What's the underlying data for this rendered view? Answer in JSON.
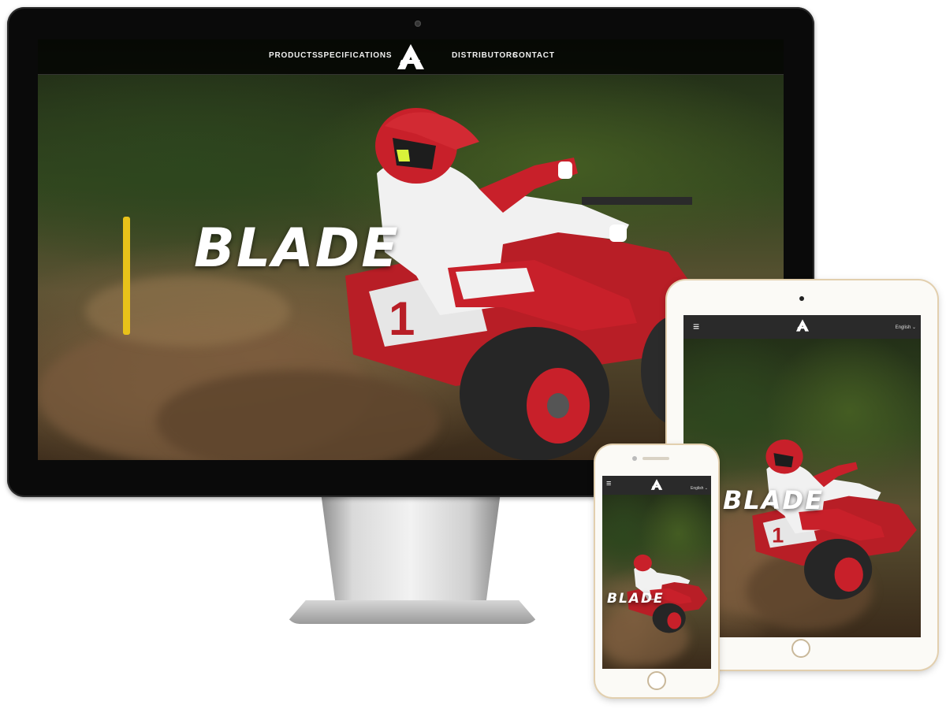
{
  "desktop": {
    "nav": {
      "left_items": [
        "PRODUCTS",
        "SPECIFICATIONS"
      ],
      "right_items": [
        "DISTRIBUTORS",
        "CONTACT"
      ]
    },
    "hero_logo_text": "BLADE"
  },
  "tablet": {
    "language": "English ⌄",
    "hero_logo_text": "BLADE"
  },
  "phone": {
    "language": "English ⌄",
    "hero_logo_text": "BLADE"
  },
  "icons": {
    "menu": "hamburger-icon",
    "brand": "blade-logo-mark"
  },
  "colors": {
    "nav_bg": "#000000",
    "accent_red": "#c8202a",
    "device_gold": "#e2cfae"
  }
}
